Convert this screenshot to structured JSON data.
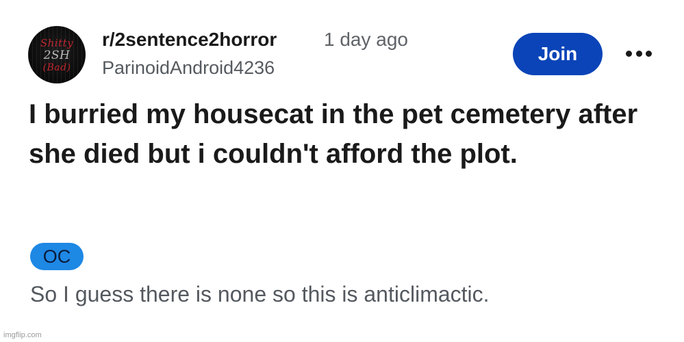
{
  "post": {
    "avatar": {
      "text_line1": "Shitty",
      "text_line2": "2SH",
      "text_line3": "(Bad)"
    },
    "subreddit": "r/2sentence2horror",
    "time": "1 day ago",
    "username": "ParinoidAndroid4236",
    "join_label": "Join",
    "more_icon": "more-horizontal-icon",
    "title": "I burried my housecat in the pet cemetery after she died but i couldn't afford the plot.",
    "flair": "OC",
    "body": "So I guess there is none so this is anticlimactic."
  },
  "colors": {
    "join_bg": "#0a44b8",
    "flair_bg": "#1e88e5",
    "avatar_red": "#c0262f"
  },
  "watermark": "imgflip.com"
}
